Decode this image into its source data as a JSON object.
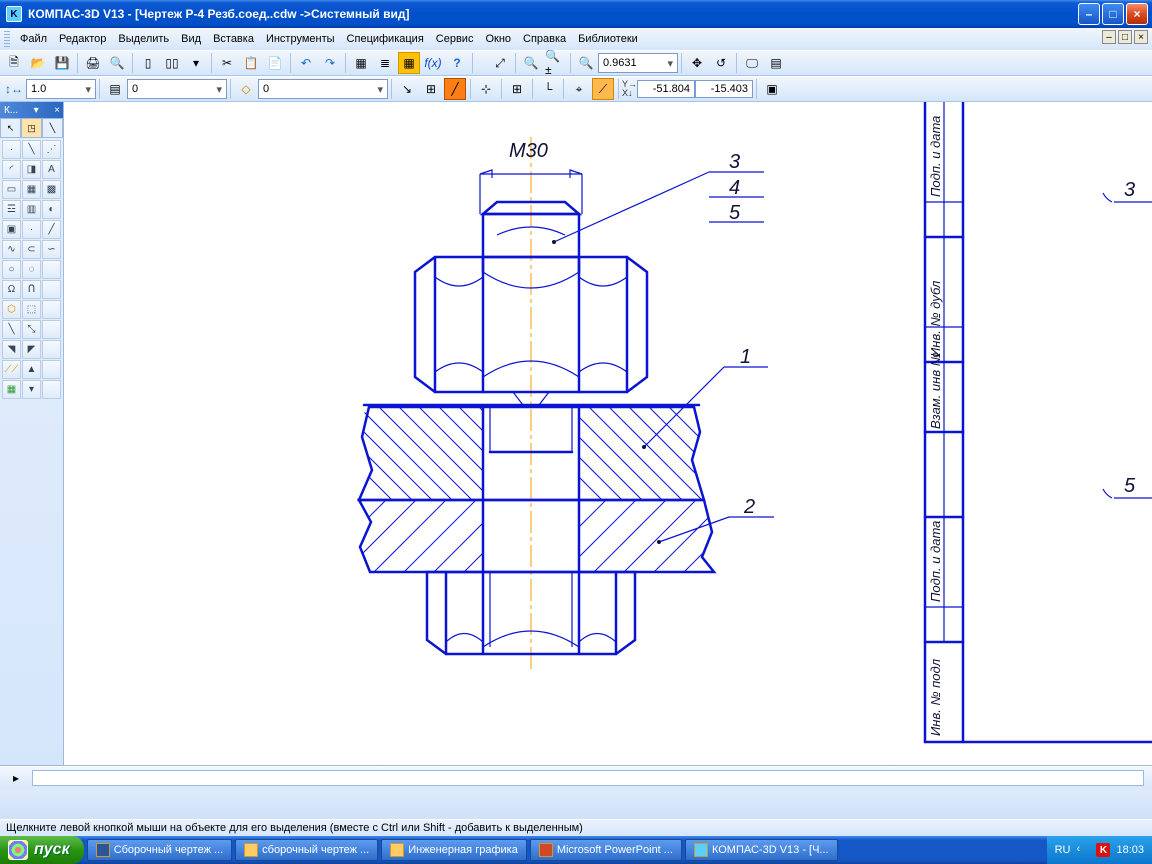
{
  "title": "КОМПАС-3D V13 - [Чертеж Р-4 Резб.соед..cdw ->Системный вид]",
  "menu": {
    "file": "Файл",
    "edit": "Редактор",
    "select": "Выделить",
    "view": "Вид",
    "insert": "Вставка",
    "tools": "Инструменты",
    "spec": "Спецификация",
    "service": "Сервис",
    "window": "Окно",
    "help": "Справка",
    "libs": "Библиотеки"
  },
  "toolbar2": {
    "zoom": "0.9631"
  },
  "toolbar3": {
    "combo1": "1.0",
    "combo2": "0",
    "combo3": "0",
    "coordX": "-51.804",
    "coordY": "-15.403",
    "xyLabel": "Y→\nX↓"
  },
  "palette": {
    "title": "К..."
  },
  "drawing": {
    "dim": "М30",
    "callout_3": "3",
    "callout_4": "4",
    "callout_5": "5",
    "callout_1": "1",
    "callout_2": "2",
    "right_3": "3",
    "right_5": "5"
  },
  "titleblock_labels": [
    "Подп. и дата",
    "Инв. № дубл",
    "Взам. инв №",
    "Подп. и дата",
    "Инв. № подл"
  ],
  "status": "Щелкните левой кнопкой мыши на объекте для его выделения (вместе с Ctrl или Shift - добавить к выделенным)",
  "taskbar": {
    "start": "пуск",
    "items": [
      {
        "cls": "Word",
        "label": "Сборочный чертеж ..."
      },
      {
        "cls": "Fold",
        "label": "сборочный чертеж ..."
      },
      {
        "cls": "Fold",
        "label": "Инженерная графика"
      },
      {
        "cls": "PPT",
        "label": "Microsoft PowerPoint ..."
      },
      {
        "cls": "Kompas",
        "label": "КОМПАС-3D V13 - [Ч..."
      }
    ],
    "lang": "RU",
    "time": "18:03"
  }
}
